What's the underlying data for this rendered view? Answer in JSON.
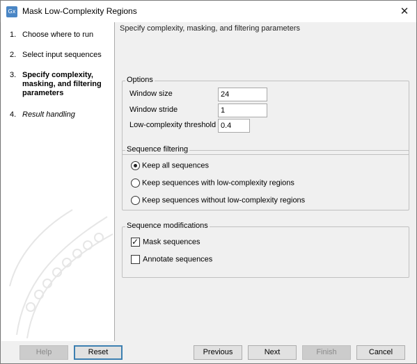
{
  "window": {
    "title": "Mask Low-Complexity Regions",
    "app_icon_text": "Gx",
    "close_symbol": "✕"
  },
  "steps": [
    {
      "num": "1.",
      "label": "Choose where to run"
    },
    {
      "num": "2.",
      "label": "Select input sequences"
    },
    {
      "num": "3.",
      "label": "Specify complexity, masking, and filtering parameters"
    },
    {
      "num": "4.",
      "label": "Result handling"
    }
  ],
  "content": {
    "header": "Specify complexity, masking, and filtering parameters",
    "options": {
      "legend": "Options",
      "window_size_label": "Window size",
      "window_size_value": "24",
      "window_stride_label": "Window stride",
      "window_stride_value": "1",
      "threshold_label": "Low-complexity threshold",
      "threshold_value": "0.4"
    },
    "filtering": {
      "legend": "Sequence filtering",
      "options": [
        "Keep all sequences",
        "Keep sequences with low-complexity regions",
        "Keep sequences without low-complexity regions"
      ],
      "selected_index": 0
    },
    "modifications": {
      "legend": "Sequence modifications",
      "mask_label": "Mask sequences",
      "mask_checked": true,
      "annotate_label": "Annotate sequences",
      "annotate_checked": false
    }
  },
  "buttons": {
    "help": "Help",
    "reset": "Reset",
    "previous": "Previous",
    "next": "Next",
    "finish": "Finish",
    "cancel": "Cancel"
  },
  "colors": {
    "focus_border": "#3c7fb1",
    "app_icon": "#4a86c5"
  }
}
